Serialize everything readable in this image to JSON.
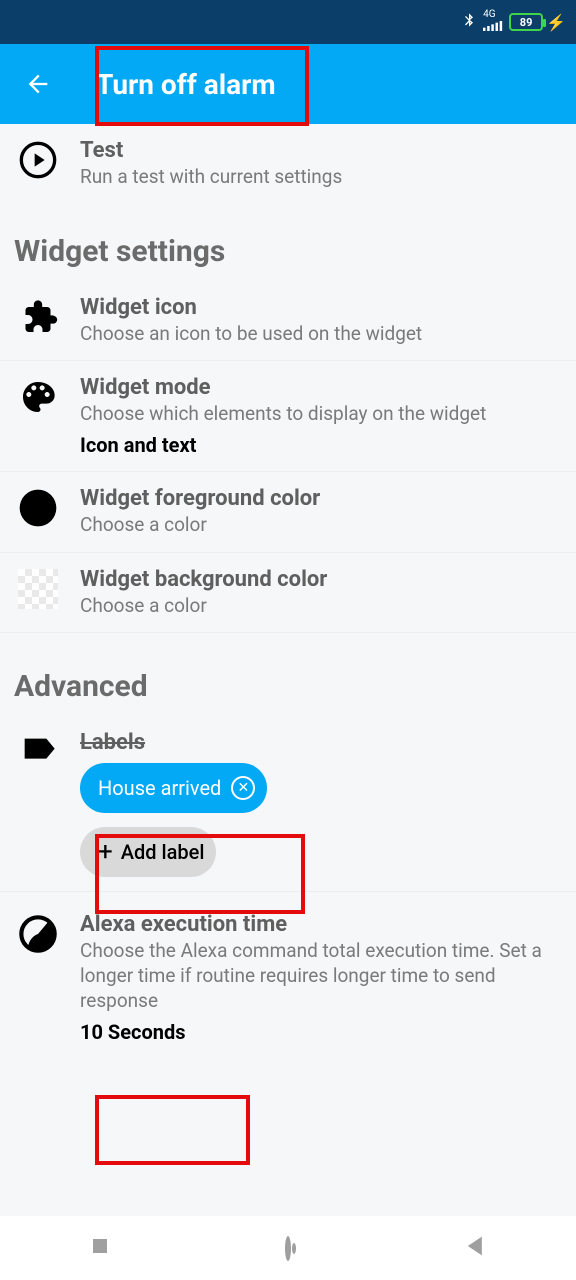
{
  "status": {
    "network": "4G",
    "battery": "89"
  },
  "appbar": {
    "title": "Turn off alarm"
  },
  "test": {
    "title": "Test",
    "sub": "Run a test with current settings"
  },
  "sections": {
    "widget_header": "Widget settings",
    "advanced_header": "Advanced"
  },
  "widget_icon": {
    "title": "Widget icon",
    "sub": "Choose an icon to be used on the widget"
  },
  "widget_mode": {
    "title": "Widget mode",
    "sub": "Choose which elements to display on the widget",
    "value": "Icon and text"
  },
  "widget_fg": {
    "title": "Widget foreground color",
    "sub": "Choose a color"
  },
  "widget_bg": {
    "title": "Widget background color",
    "sub": "Choose a color"
  },
  "labels": {
    "title": "Labels",
    "chips": {
      "0": "House arrived"
    },
    "add": "Add label"
  },
  "alexa": {
    "title": "Alexa execution time",
    "sub": "Choose the Alexa command total execution time. Set a longer time if routine requires longer time to send response",
    "value": "10 Seconds"
  }
}
